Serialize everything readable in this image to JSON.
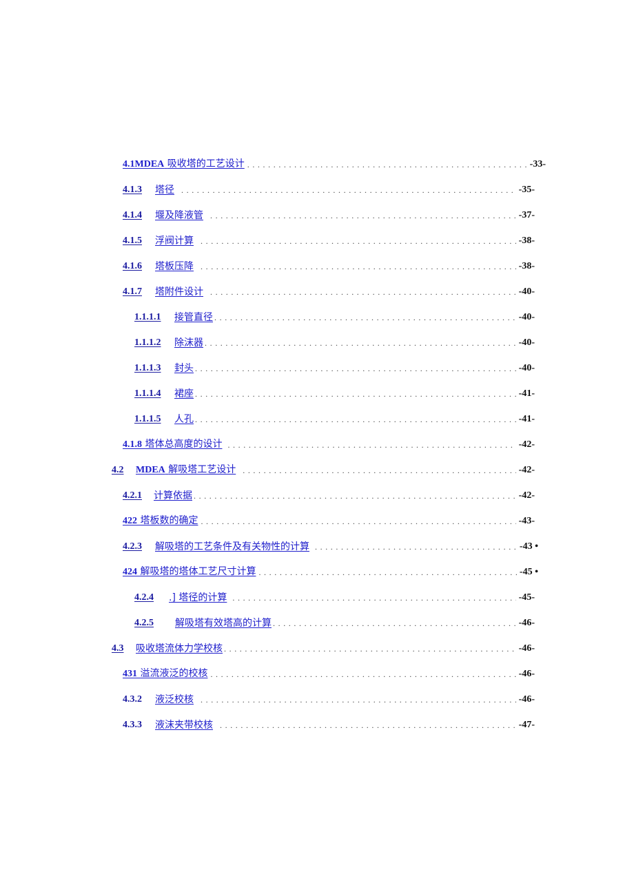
{
  "toc": {
    "entries": [
      {
        "number": "",
        "title": "4.1MDEA 吸收塔的工艺设计",
        "page": "-33-",
        "level": 1
      },
      {
        "number": "4.1.3",
        "title": "塔径",
        "page": "-35-",
        "level": 1
      },
      {
        "number": "4.1.4",
        "title": "堰及降液管",
        "page": "-37-",
        "level": 1
      },
      {
        "number": "4.1.5",
        "title": "浮阀计算",
        "page": "-38-",
        "level": 1
      },
      {
        "number": "4.1.6",
        "title": "塔板压降",
        "page": "-38-",
        "level": 1
      },
      {
        "number": "4.1.7",
        "title": "塔附件设计",
        "page": "-40-",
        "level": 1
      },
      {
        "number": "1.1.1.1",
        "title": "接管直径",
        "page": "-40-",
        "level": 2
      },
      {
        "number": "1.1.1.2",
        "title": "除沫器",
        "page": "-40-",
        "level": 2
      },
      {
        "number": "1.1.1.3",
        "title": "封头",
        "page": "-40-",
        "level": 2
      },
      {
        "number": "1.1.1.4",
        "title": "裙座",
        "page": "-41-",
        "level": 2
      },
      {
        "number": "1.1.1.5",
        "title": "人孔",
        "page": "-41-",
        "level": 2
      },
      {
        "number": "",
        "title": "4.1.8 塔体总高度的设计",
        "page": "-42-",
        "level": 1
      },
      {
        "number": "4.2",
        "title": "MDEA 解吸塔工艺设计",
        "page": "-42-",
        "level": 0
      },
      {
        "number": "4.2.1",
        "title": "计算依据",
        "page": "-42-",
        "level": 1
      },
      {
        "number": "",
        "title": "422 塔板数的确定",
        "page": "-43-",
        "level": 1
      },
      {
        "number": "4.2.3",
        "title": "解吸塔的工艺条件及有关物性的计算",
        "page": "-43 •",
        "level": 1
      },
      {
        "number": "",
        "title": "424 解吸塔的塔体工艺尺寸计算",
        "page": "-45 •",
        "level": 1
      },
      {
        "number": "4.2.4",
        "title": ".] 塔径的计算",
        "page": "-45-",
        "level": 2
      },
      {
        "number": "4.2.5",
        "title": "解吸塔有效塔高的计算",
        "page": "-46-",
        "level": 2
      },
      {
        "number": "4.3",
        "title": "吸收塔流体力学校核",
        "page": "-46-",
        "level": 0
      },
      {
        "number": "",
        "title": "431 溢流液泛的校核",
        "page": "-46-",
        "level": 1
      },
      {
        "number": "4.3.2",
        "title": "液泛校核",
        "page": "-46-",
        "level": 1
      },
      {
        "number": "4.3.3",
        "title": "液沫夹带校核",
        "page": "-47-",
        "level": 1
      }
    ],
    "leader": "................................................................................................................................"
  },
  "colors": {
    "link": "#2020cc",
    "number": "#1a1aa0",
    "page_number": "#111111",
    "leader": "#444444",
    "background": "#ffffff"
  }
}
